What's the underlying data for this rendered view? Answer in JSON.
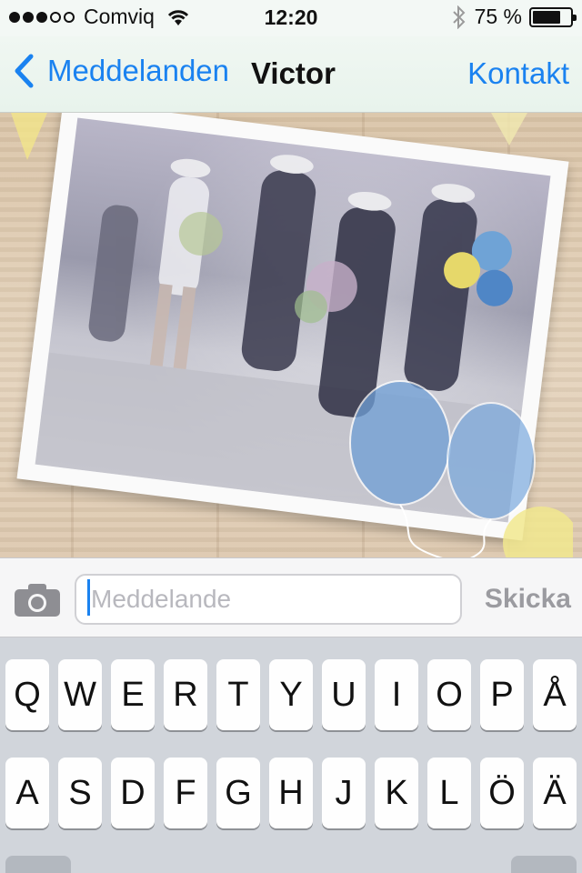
{
  "status_bar": {
    "carrier": "Comviq",
    "signal_bars_filled": 3,
    "signal_bars_total": 5,
    "time": "12:20",
    "battery_percent_label": "75 %",
    "battery_level": 0.75
  },
  "nav": {
    "back_label": "Meddelanden",
    "title": "Victor",
    "contact_label": "Kontakt"
  },
  "input": {
    "placeholder": "Meddelande",
    "send_label": "Skicka"
  },
  "keyboard": {
    "row1": [
      "Q",
      "W",
      "E",
      "R",
      "T",
      "Y",
      "U",
      "I",
      "O",
      "P",
      "Å"
    ],
    "row2": [
      "A",
      "S",
      "D",
      "F",
      "G",
      "H",
      "J",
      "K",
      "L",
      "Ö",
      "Ä"
    ]
  },
  "colors": {
    "accent": "#1a82f0",
    "send_disabled": "#9b9ba0"
  }
}
